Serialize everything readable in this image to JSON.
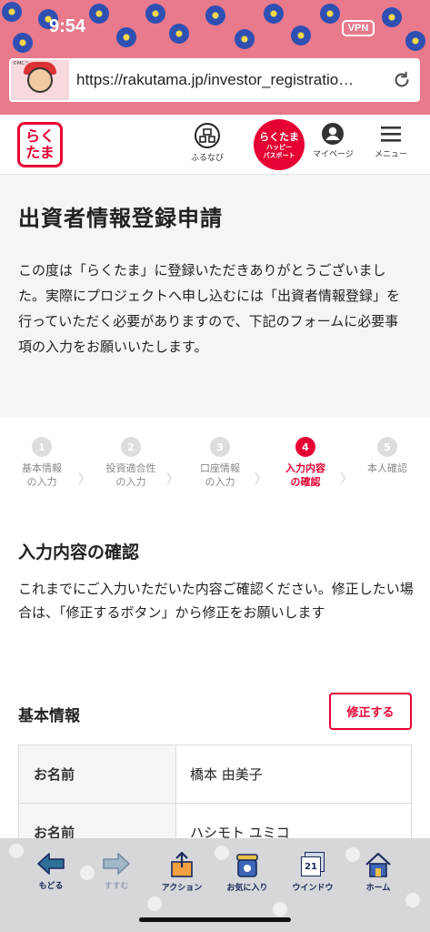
{
  "status_bar": {
    "time": "9:54",
    "vpn": "VPN"
  },
  "browser": {
    "url": "https://rakutama.jp/investor_registratio…",
    "thumb_tag": "©MC™"
  },
  "site_header": {
    "logo_line1": "らく",
    "logo_line2": "たま",
    "furunavi_label": "ふるなび",
    "passport_line1": "らくたま",
    "passport_line2": "ハッピー",
    "passport_line3": "パスポート",
    "mypage_label": "マイページ",
    "menu_label": "メニュー"
  },
  "intro": {
    "title": "出資者情報登録申請",
    "text": "この度は「らくたま」に登録いただきありがとうございました。実際にプロジェクトへ申し込むには「出資者情報登録」を行っていただく必要がありますので、下記のフォームに必要事項の入力をお願いいたします。"
  },
  "stepper": {
    "active_step": 4,
    "steps": [
      {
        "num": "1",
        "label": "基本情報\nの入力"
      },
      {
        "num": "2",
        "label": "投資適合性\nの入力"
      },
      {
        "num": "3",
        "label": "口座情報\nの入力"
      },
      {
        "num": "4",
        "label": "入力内容\nの確認"
      },
      {
        "num": "5",
        "label": "本人確認"
      }
    ]
  },
  "confirm": {
    "title": "入力内容の確認",
    "text": "これまでにご入力いただいた内容ご確認ください。修正したい場合は、「修正するボタン」から修正をお願いします"
  },
  "basic_info": {
    "title": "基本情報",
    "edit_label": "修正する",
    "rows": [
      {
        "key": "お名前",
        "value": "橋本 由美子"
      },
      {
        "key": "お名前",
        "value": "ハシモト ユミコ"
      }
    ]
  },
  "toolbar": {
    "back_label": "もどる",
    "forward_label": "すすむ",
    "action_label": "アクション",
    "bookmark_label": "お気に入り",
    "window_label": "ウインドウ",
    "window_count": "21",
    "home_label": "ホーム"
  },
  "colors": {
    "accent": "#e60033",
    "chrome": "#e87a8c",
    "toolbar": "#d5d7da"
  }
}
